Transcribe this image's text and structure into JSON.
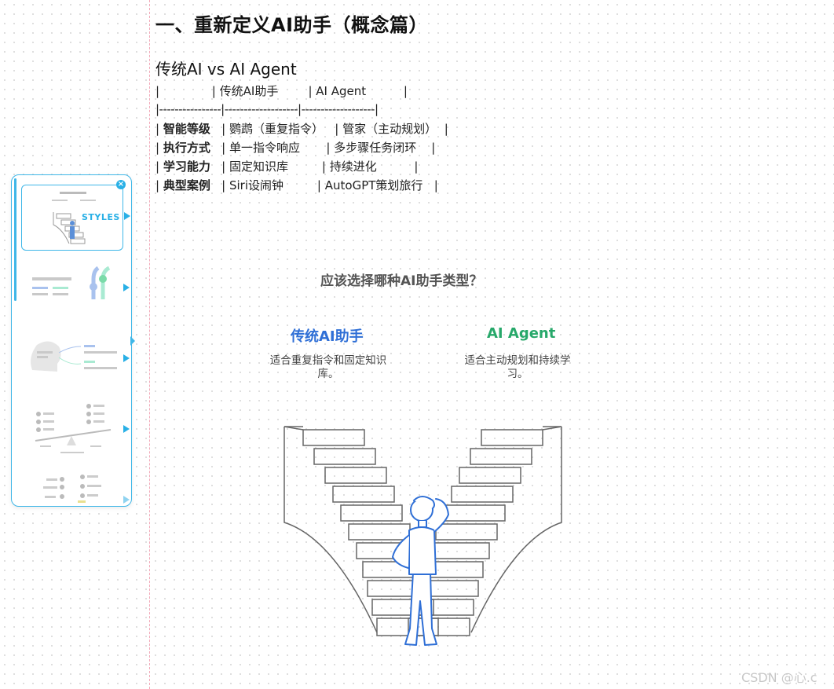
{
  "doc": {
    "heading": "一、重新定义AI助手（概念篇）",
    "subheading": "传统AI vs AI Agent",
    "table": {
      "header_line": "|              | 传统AI助手        | AI Agent          |",
      "separator_line": "|----------------|-------------------|-------------------|",
      "rows": [
        {
          "label": "智能等级",
          "c1": "鹦鹉（重复指令）",
          "c2": "管家（主动规划）"
        },
        {
          "label": "执行方式",
          "c1": "单一指令响应",
          "c2": "多步骤任务闭环"
        },
        {
          "label": "学习能力",
          "c1": "固定知识库",
          "c2": "持续进化"
        },
        {
          "label": "典型案例",
          "c1": "Siri设闹钟",
          "c2": "AutoGPT策划旅行"
        }
      ]
    }
  },
  "infographic": {
    "question": "应该选择哪种AI助手类型？",
    "options": [
      {
        "title": "传统AI助手",
        "desc": "适合重复指令和固定知识库。",
        "color": "#2f6fd6"
      },
      {
        "title": "AI Agent",
        "desc": "适合主动规划和持续学习。",
        "color": "#27a86a"
      }
    ],
    "illustration_icon": "person-at-two-staircases"
  },
  "style_panel": {
    "styles_label": "STYLES",
    "close_icon": "close-icon",
    "accent": "#29b0e6"
  },
  "watermark": "CSDN @心.c"
}
